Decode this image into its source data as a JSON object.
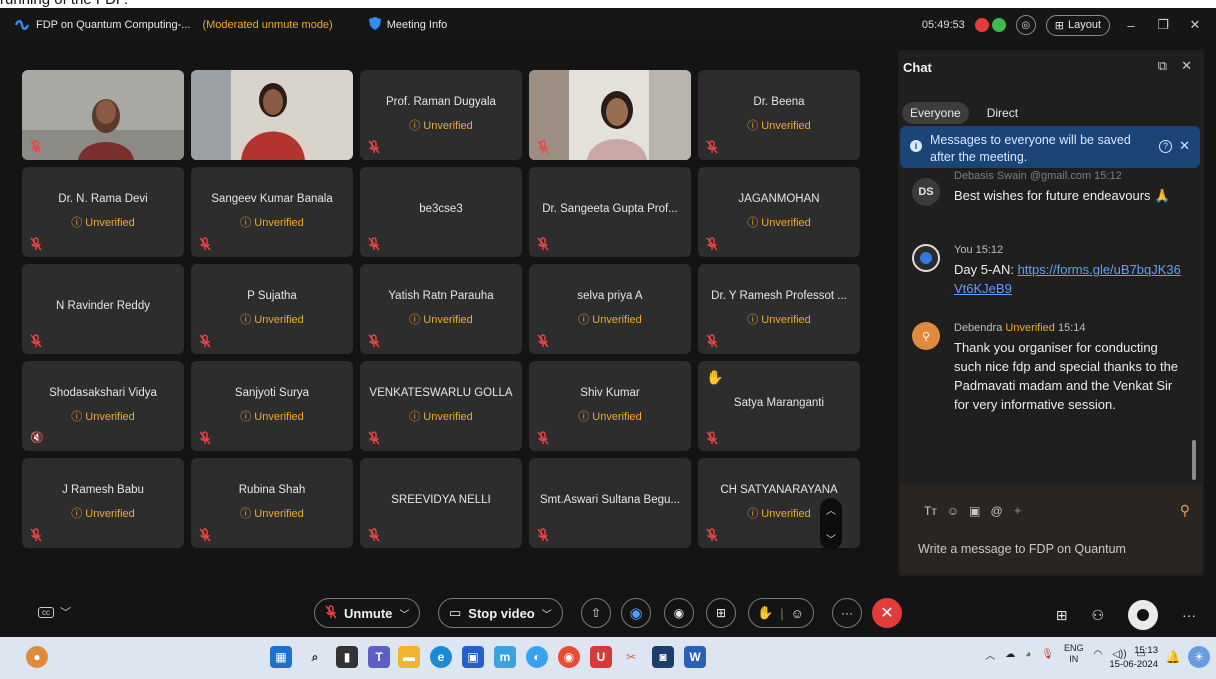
{
  "caption": {
    "text": "running of the FDP."
  },
  "titlebar": {
    "meeting_title": "FDP on Quantum Computing-...",
    "mode": "(Moderated unmute mode)",
    "meeting_info": "Meeting Info",
    "timer": "05:49:53",
    "layout_label": "Layout",
    "colors": {
      "mode": "#f2a928",
      "rec_red": "#e43b3b",
      "rec_green": "#3fb950"
    }
  },
  "participants": [
    {
      "name": "",
      "status": "",
      "video": true,
      "muted": true
    },
    {
      "name": "",
      "status": "",
      "video": true,
      "muted": false
    },
    {
      "name": "Prof. Raman Dugyala",
      "status": "Unverified",
      "video": false,
      "muted": true
    },
    {
      "name": "",
      "status": "",
      "video": true,
      "muted": true
    },
    {
      "name": "Dr. Beena",
      "status": "Unverified",
      "video": false,
      "muted": true
    },
    {
      "name": "Dr. N. Rama Devi",
      "status": "Unverified",
      "video": false,
      "muted": true
    },
    {
      "name": "Sangeev Kumar Banala",
      "status": "Unverified",
      "video": false,
      "muted": true
    },
    {
      "name": "be3cse3",
      "status": "",
      "video": false,
      "muted": true
    },
    {
      "name": "Dr. Sangeeta Gupta Prof...",
      "status": "",
      "video": false,
      "muted": true
    },
    {
      "name": "JAGANMOHAN",
      "status": "Unverified",
      "video": false,
      "muted": true
    },
    {
      "name": "N Ravinder Reddy",
      "status": "",
      "video": false,
      "muted": true
    },
    {
      "name": "P Sujatha",
      "status": "Unverified",
      "video": false,
      "muted": true
    },
    {
      "name": "Yatish Ratn Parauha",
      "status": "Unverified",
      "video": false,
      "muted": true
    },
    {
      "name": "selva priya A",
      "status": "Unverified",
      "video": false,
      "muted": true
    },
    {
      "name": "Dr. Y Ramesh Professot ...",
      "status": "Unverified",
      "video": false,
      "muted": true
    },
    {
      "name": "Shodasakshari Vidya",
      "status": "Unverified",
      "video": false,
      "muted": false,
      "speaker_off": true
    },
    {
      "name": "Sanjyoti Surya",
      "status": "Unverified",
      "video": false,
      "muted": true
    },
    {
      "name": "VENKATESWARLU GOLLA",
      "status": "Unverified",
      "video": false,
      "muted": true
    },
    {
      "name": "Shiv Kumar",
      "status": "Unverified",
      "video": false,
      "muted": true
    },
    {
      "name": "Satya Maranganti",
      "status": "",
      "video": false,
      "muted": true,
      "hand_raised": true
    },
    {
      "name": "J Ramesh Babu",
      "status": "Unverified",
      "video": false,
      "muted": true
    },
    {
      "name": "Rubina Shah",
      "status": "Unverified",
      "video": false,
      "muted": true
    },
    {
      "name": "SREEVIDYA NELLI",
      "status": "",
      "video": false,
      "muted": true
    },
    {
      "name": "Smt.Aswari Sultana Begu...",
      "status": "",
      "video": false,
      "muted": true
    },
    {
      "name": "CH SATYANARAYANA",
      "status": "Unverified",
      "video": false,
      "muted": true
    }
  ],
  "chat": {
    "title": "Chat",
    "tabs": [
      "Everyone",
      "Direct"
    ],
    "notice": "Messages to everyone will be saved after the meeting.",
    "messages": [
      {
        "initials": "DS",
        "meta": "Debasis Swain  @gmail.com 15:12",
        "verified": "",
        "body": "Best wishes for future endeavours 🙏",
        "avatar_color": "#3b3b3b"
      },
      {
        "initials": "",
        "meta": "You 15:12",
        "verified": "",
        "body_prefix": "Day 5-AN: ",
        "link": "https://forms.gle/uB7bqJK36Vt6KJeB9",
        "link_display": "https://forms.gle/\nuB7bqJK36Vt6KJeB9",
        "avatar_color": "#2f7be6"
      },
      {
        "initials": "",
        "meta_name": "Debendra",
        "meta_status": "Unverified",
        "meta_time": "15:14",
        "body": "Thank you organiser for conducting such nice fdp and special thanks to the Padmavati madam and the Venkat Sir for very informative session.",
        "avatar_color": "#e08a3c"
      }
    ],
    "compose_placeholder": "Write a message to FDP on Quantum",
    "compose_tools": [
      "Tт",
      "☺",
      "▣",
      "@",
      "✦"
    ]
  },
  "controls": {
    "unmute": "Unmute",
    "stop_video": "Stop video",
    "colors": {
      "end": "#e23b3b"
    }
  },
  "taskbar": {
    "lang_top": "ENG",
    "lang_bottom": "IN",
    "time": "15:13",
    "date": "15-06-2024"
  }
}
